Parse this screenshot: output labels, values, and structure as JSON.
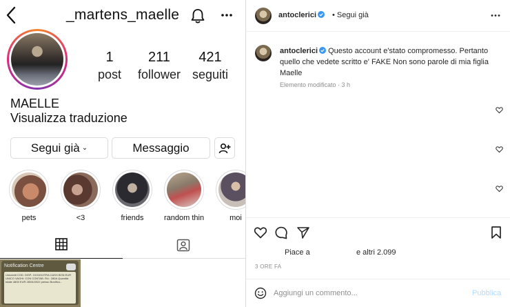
{
  "profile": {
    "username": "_martens_maelle",
    "stats": [
      {
        "num": "1",
        "label": "post"
      },
      {
        "num": "211",
        "label": "follower"
      },
      {
        "num": "421",
        "label": "seguiti"
      }
    ],
    "name": "MAELLE",
    "translate": "Visualizza traduzione",
    "follow_label": "Segui già",
    "follow_chevron": "⌄",
    "message_label": "Messaggio",
    "highlights": [
      {
        "label": "pets",
        "color": "#c98a6a"
      },
      {
        "label": "<3",
        "color": "#8a6a5a"
      },
      {
        "label": "friends",
        "color": "#4a4a50"
      },
      {
        "label": "random thin...",
        "color": "#9a8a7a"
      },
      {
        "label": "moi",
        "color": "#b0a8a0"
      }
    ],
    "thumb": {
      "title": "Notification Centre",
      "body": "Unicredit  COD. DISP.: 0101010TRA CASH BON EUR UNICO  VAGHI: CON CONTAB.  Fid.: 280A  Quantità totale 4800 EUR  28/04/2022  presso Bonifico..."
    }
  },
  "post": {
    "author": "antoclerici",
    "follow_status": "Segui già",
    "comment_text": "Questo account e'stato compromesso. Pertanto quello che vedete scritto e' FAKE Non sono parole di mia figlia Maelle",
    "comment_meta": "Elemento modificato · 3 h",
    "likes_prefix": "Piace a",
    "likes_suffix": "e altri 2.099",
    "time": "3 ORE FA",
    "comment_placeholder": "Aggiungi un commento...",
    "publish_label": "Pubblica",
    "colors": {
      "verified": "#3897f0",
      "publish": "#b3dbff"
    }
  }
}
